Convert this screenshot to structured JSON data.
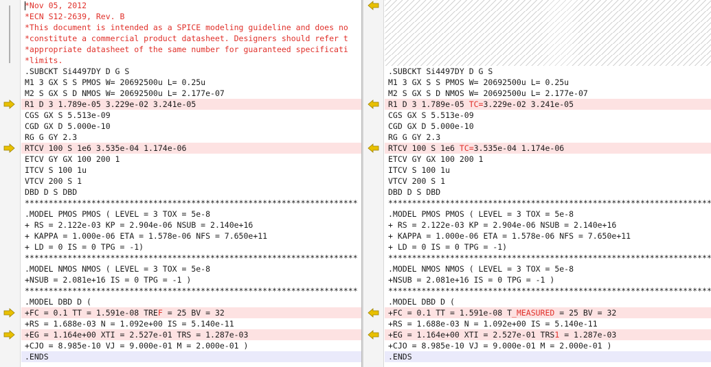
{
  "colors": {
    "changed_bg": "#fde2e2",
    "highlight_text": "#e0302a",
    "marker": "#e8c000",
    "ends_bg": "#eaeafb"
  },
  "left": {
    "lines": [
      {
        "text": "*Nov 05, 2012",
        "type": "comment"
      },
      {
        "text": "*ECN S12-2639, Rev. B",
        "type": "comment"
      },
      {
        "text": "*This document is intended as a SPICE modeling guideline and does no",
        "type": "comment"
      },
      {
        "text": "*constitute a commercial product datasheet. Designers should refer t",
        "type": "comment"
      },
      {
        "text": "*appropriate datasheet of the same number for guaranteed specificati",
        "type": "comment"
      },
      {
        "text": "*limits.",
        "type": "comment"
      },
      {
        "text": ".SUBCKT Si4497DY D G S"
      },
      {
        "text": "M1 3 GX S S PMOS W= 20692500u L= 0.25u"
      },
      {
        "text": "M2 S GX S D NMOS W= 20692500u L= 2.177e-07"
      },
      {
        "text": "R1 D 3 1.789e-05 3.229e-02 3.241e-05",
        "type": "changed",
        "marker": true
      },
      {
        "text": "CGS GX S 5.513e-09"
      },
      {
        "text": "CGD GX D 5.000e-10"
      },
      {
        "text": "RG G GY 2.3"
      },
      {
        "text": "RTCV 100 S 1e6 3.535e-04 1.174e-06",
        "type": "changed",
        "marker": true
      },
      {
        "text": "ETCV GY GX 100 200 1"
      },
      {
        "text": "ITCV S 100 1u"
      },
      {
        "text": "VTCV 200 S 1"
      },
      {
        "text": "DBD D S DBD"
      },
      {
        "text": "**********************************************************************"
      },
      {
        "text": ".MODEL PMOS PMOS ( LEVEL = 3 TOX = 5e-8"
      },
      {
        "text": "+ RS = 2.122e-03 KP = 2.904e-06 NSUB = 2.140e+16"
      },
      {
        "text": "+ KAPPA = 1.000e-06 ETA = 1.578e-06 NFS = 7.650e+11"
      },
      {
        "text": "+ LD = 0 IS = 0 TPG = -1)"
      },
      {
        "text": "**********************************************************************"
      },
      {
        "text": ".MODEL NMOS NMOS ( LEVEL = 3 TOX = 5e-8"
      },
      {
        "text": "+NSUB = 2.081e+16 IS = 0 TPG = -1 )"
      },
      {
        "text": "**********************************************************************"
      },
      {
        "text": ".MODEL DBD D ("
      },
      {
        "text": "+FC = 0.1 TT = 1.591e-08 TREF = 25 BV = 32",
        "type": "changed",
        "marker": true,
        "pre": "+FC = 0.1 TT = 1.591e-08 TRE",
        "hl": "F",
        "post": " = 25 BV = 32"
      },
      {
        "text": "+RS = 1.688e-03 N = 1.092e+00 IS = 5.140e-11"
      },
      {
        "text": "+EG = 1.164e+00 XTI = 2.527e-01 TRS = 1.287e-03",
        "type": "changed",
        "marker": true
      },
      {
        "text": "+CJO = 8.985e-10 VJ = 9.000e-01 M = 2.000e-01 )"
      },
      {
        "text": ".ENDS",
        "type": "ends"
      }
    ]
  },
  "right": {
    "lines": [
      {
        "text": "",
        "type": "empty",
        "marker": true
      },
      {
        "text": "",
        "type": "empty"
      },
      {
        "text": "",
        "type": "empty"
      },
      {
        "text": "",
        "type": "empty"
      },
      {
        "text": "",
        "type": "empty"
      },
      {
        "text": "",
        "type": "empty"
      },
      {
        "text": ".SUBCKT Si4497DY D G S"
      },
      {
        "text": "M1 3 GX S S PMOS W= 20692500u L= 0.25u"
      },
      {
        "text": "M2 S GX S D NMOS W= 20692500u L= 2.177e-07"
      },
      {
        "text": "R1 D 3 1.789e-05 TC=3.229e-02 3.241e-05",
        "type": "changed",
        "marker": true,
        "pre": "R1 D 3 1.789e-05 ",
        "hl": "TC=",
        "post": "3.229e-02 3.241e-05"
      },
      {
        "text": "CGS GX S 5.513e-09"
      },
      {
        "text": "CGD GX D 5.000e-10"
      },
      {
        "text": "RG G GY 2.3"
      },
      {
        "text": "RTCV 100 S 1e6 TC=3.535e-04 1.174e-06",
        "type": "changed",
        "marker": true,
        "pre": "RTCV 100 S 1e6 ",
        "hl": "TC=",
        "post": "3.535e-04 1.174e-06"
      },
      {
        "text": "ETCV GY GX 100 200 1"
      },
      {
        "text": "ITCV S 100 1u"
      },
      {
        "text": "VTCV 200 S 1"
      },
      {
        "text": "DBD D S DBD"
      },
      {
        "text": "**********************************************************************"
      },
      {
        "text": ".MODEL PMOS PMOS ( LEVEL = 3 TOX = 5e-8"
      },
      {
        "text": "+ RS = 2.122e-03 KP = 2.904e-06 NSUB = 2.140e+16"
      },
      {
        "text": "+ KAPPA = 1.000e-06 ETA = 1.578e-06 NFS = 7.650e+11"
      },
      {
        "text": "+ LD = 0 IS = 0 TPG = -1)"
      },
      {
        "text": "**********************************************************************"
      },
      {
        "text": ".MODEL NMOS NMOS ( LEVEL = 3 TOX = 5e-8"
      },
      {
        "text": "+NSUB = 2.081e+16 IS = 0 TPG = -1 )"
      },
      {
        "text": "**********************************************************************"
      },
      {
        "text": ".MODEL DBD D ("
      },
      {
        "text": "+FC = 0.1 TT = 1.591e-08 T_MEASURED = 25 BV = 32",
        "type": "changed",
        "marker": true,
        "pre": "+FC = 0.1 TT = 1.591e-08 T",
        "hl": "_MEASURED",
        "post": " = 25 BV = 32"
      },
      {
        "text": "+RS = 1.688e-03 N = 1.092e+00 IS = 5.140e-11"
      },
      {
        "text": "+EG = 1.164e+00 XTI = 2.527e-01 TRS1 = 1.287e-03",
        "type": "changed",
        "marker": true,
        "pre": "+EG = 1.164e+00 XTI = 2.527e-01 TRS",
        "hl": "1",
        "post": " = 1.287e-03"
      },
      {
        "text": "+CJO = 8.985e-10 VJ = 9.000e-01 M = 2.000e-01 )"
      },
      {
        "text": ".ENDS",
        "type": "ends"
      }
    ]
  }
}
